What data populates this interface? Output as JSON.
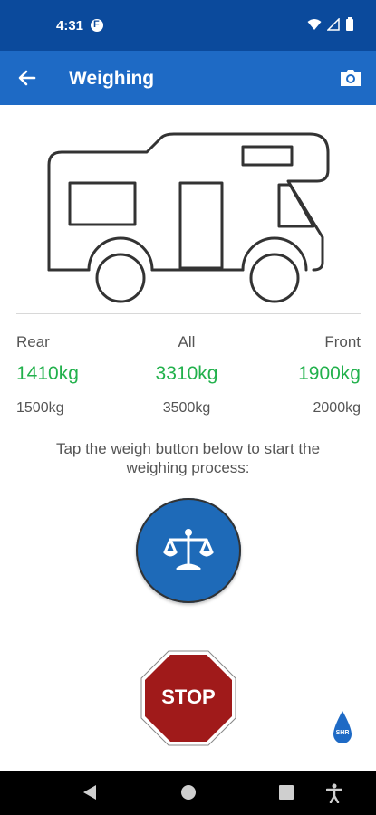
{
  "status_bar": {
    "time": "4:31"
  },
  "app_bar": {
    "title": "Weighing"
  },
  "weights": {
    "rear": {
      "label": "Rear",
      "value": "1410kg",
      "limit": "1500kg"
    },
    "all": {
      "label": "All",
      "value": "3310kg",
      "limit": "3500kg"
    },
    "front": {
      "label": "Front",
      "value": "1900kg",
      "limit": "2000kg"
    }
  },
  "instruction": "Tap the weigh button below to start the weighing process:",
  "stop_button": {
    "label": "STOP"
  },
  "badge": {
    "text": "SHR"
  },
  "colors": {
    "status_bar": "#0b4a9c",
    "app_bar": "#1e6ac5",
    "value_green": "#22b14c",
    "weigh_blue": "#1e6ab8",
    "stop_red": "#a01a1a"
  }
}
